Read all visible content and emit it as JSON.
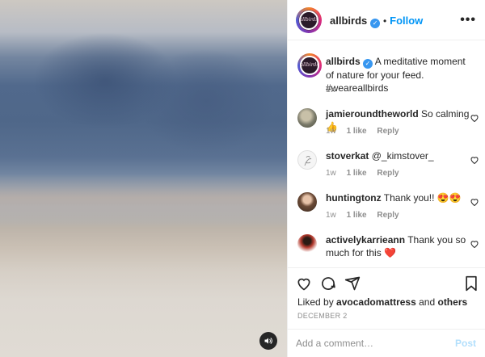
{
  "post": {
    "username": "allbirds",
    "avatar_text": "allbirds",
    "follow_label": "Follow",
    "separator": "•",
    "more_label": "•••",
    "caption": "A meditative moment of nature for your feed. #weareallbirds",
    "caption_time": "1w"
  },
  "comments": [
    {
      "username": "jamieroundtheworld",
      "text": "So calming 👍",
      "time": "1w",
      "likes": "1 like",
      "reply": "Reply"
    },
    {
      "username": "stoverkat",
      "text": "@_kimstover_",
      "time": "1w",
      "likes": "1 like",
      "reply": "Reply"
    },
    {
      "username": "huntingtonz",
      "text": "Thank you!! 😍😍",
      "time": "1w",
      "likes": "1 like",
      "reply": "Reply"
    },
    {
      "username": "activelykarrieann",
      "text": "Thank you so much for this ❤️",
      "time": "1w",
      "likes": "1 like",
      "reply": "Reply"
    }
  ],
  "likes": {
    "prefix": "Liked by",
    "user": "avocadomattress",
    "conj": "and",
    "others": "others"
  },
  "date": "DECEMBER 2",
  "add_comment": {
    "placeholder": "Add a comment…",
    "post_label": "Post"
  },
  "colors": {
    "accent": "#0095f6",
    "verified": "#3897f0",
    "muted": "#8e8e8e"
  },
  "icons": [
    "volume-icon",
    "verified-icon",
    "more-icon",
    "heart-icon",
    "comment-icon",
    "share-icon",
    "bookmark-icon"
  ]
}
